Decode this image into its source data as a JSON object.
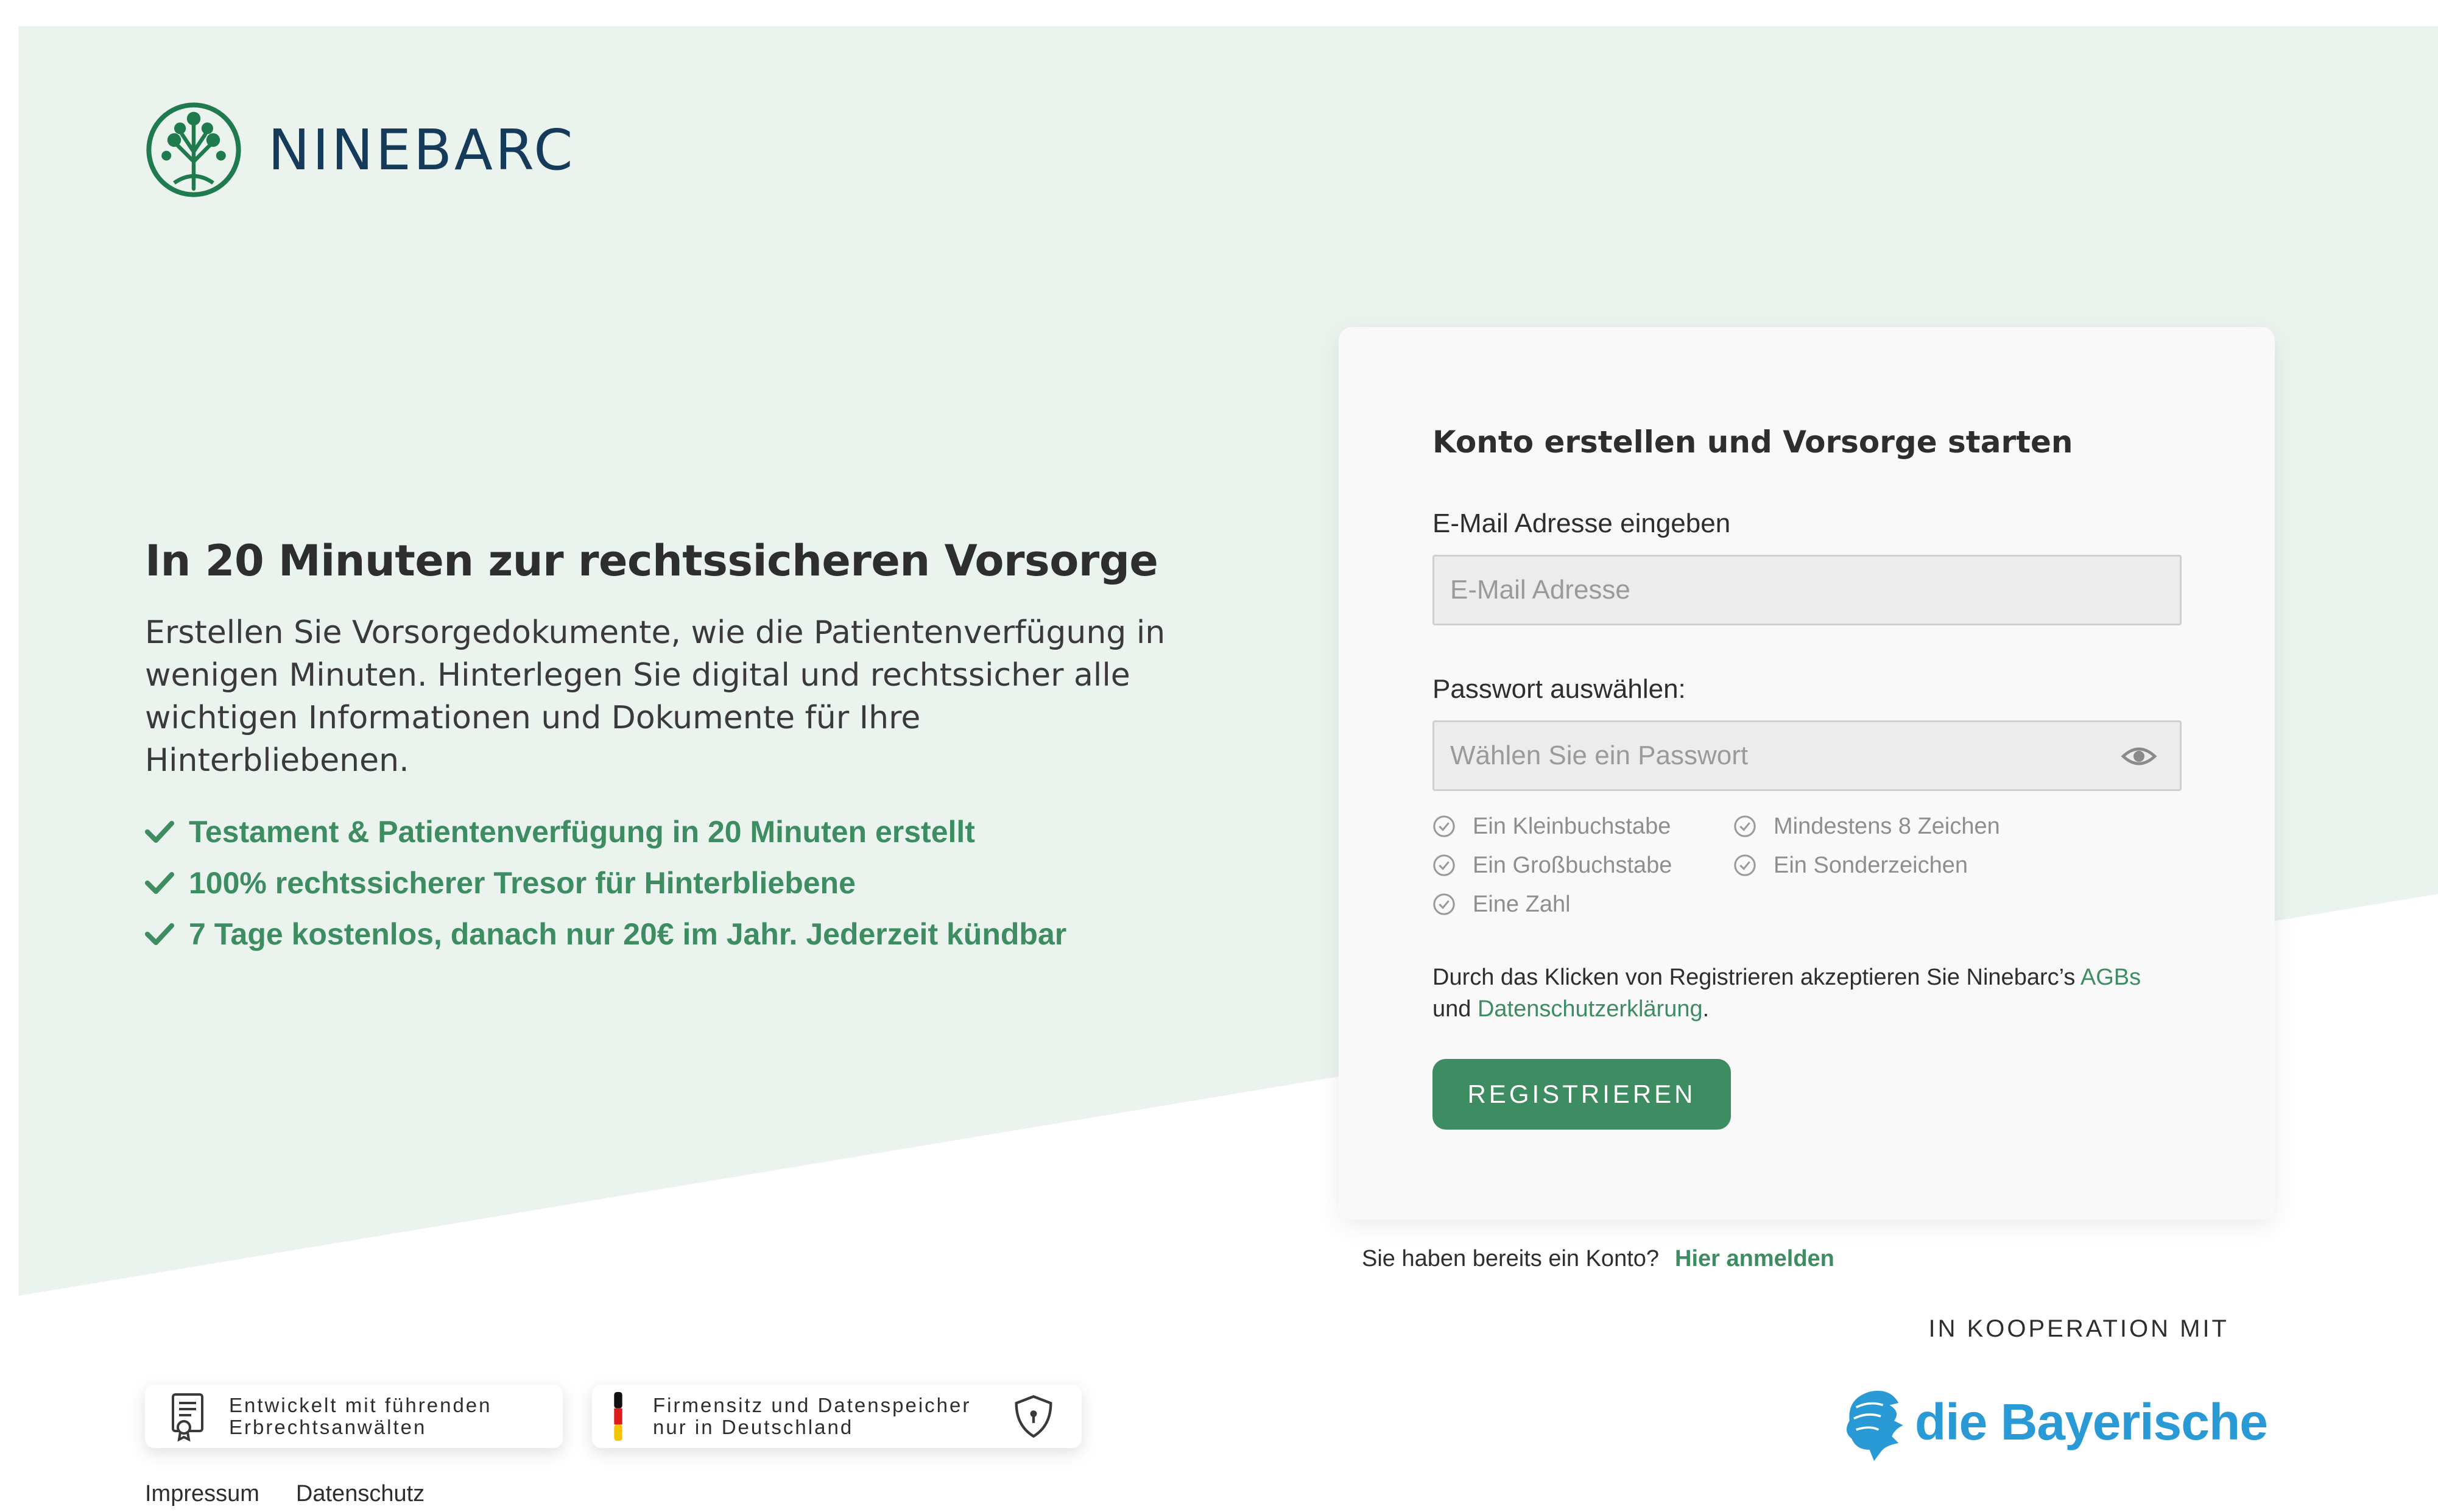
{
  "colors": {
    "brand_green": "#3d8c62",
    "logo_blue": "#163a5a",
    "band_bg": "#eaf3ee",
    "partner_blue": "#2a9ad6"
  },
  "brand": {
    "logo_text": "NINEBARC",
    "logo_icon": "tree-in-circle-icon"
  },
  "hero": {
    "title": "In 20 Minuten zur rechtssicheren Vorsorge",
    "text": "Erstellen Sie Vorsorgedokumente, wie die Patientenverfügung in wenigen Minuten. Hinterlegen Sie digital und rechtssicher alle wichtigen Informationen und Dokumente für Ihre Hinterbliebenen.",
    "features": [
      "Testament & Patientenverfügung in 20 Minuten erstellt",
      "100% rechtssicherer Tresor für Hinterbliebene",
      "7 Tage kostenlos, danach nur 20€ im Jahr. Jederzeit kündbar"
    ]
  },
  "form": {
    "title": "Konto erstellen und Vorsorge starten",
    "email_label": "E-Mail Adresse eingeben",
    "email_placeholder": "E-Mail Adresse",
    "email_value": "",
    "password_label": "Passwort auswählen:",
    "password_placeholder": "Wählen Sie ein Passwort",
    "password_value": "",
    "password_rules": [
      "Ein Kleinbuchstabe",
      "Mindestens 8 Zeichen",
      "Ein Großbuchstabe",
      "Ein Sonderzeichen",
      "Eine Zahl"
    ],
    "terms_prefix": "Durch das Klicken von Registrieren akzeptieren Sie Ninebarc’s ",
    "terms_agb": "AGBs",
    "terms_und": "und ",
    "terms_privacy": "Datenschutzerklärung",
    "terms_suffix": ".",
    "submit_label": "REGISTRIEREN"
  },
  "login": {
    "prompt": "Sie haben bereits ein Konto?",
    "link": "Hier anmelden"
  },
  "partner": {
    "caption": "IN KOOPERATION MIT",
    "name": "die Bayerische"
  },
  "badges": [
    {
      "line1": "Entwickelt mit führenden",
      "line2": "Erbrechtsanwälten"
    },
    {
      "line1": "Firmensitz und Datenspeicher",
      "line2": "nur in Deutschland"
    }
  ],
  "footer": {
    "impressum": "Impressum",
    "datenschutz": "Datenschutz"
  }
}
